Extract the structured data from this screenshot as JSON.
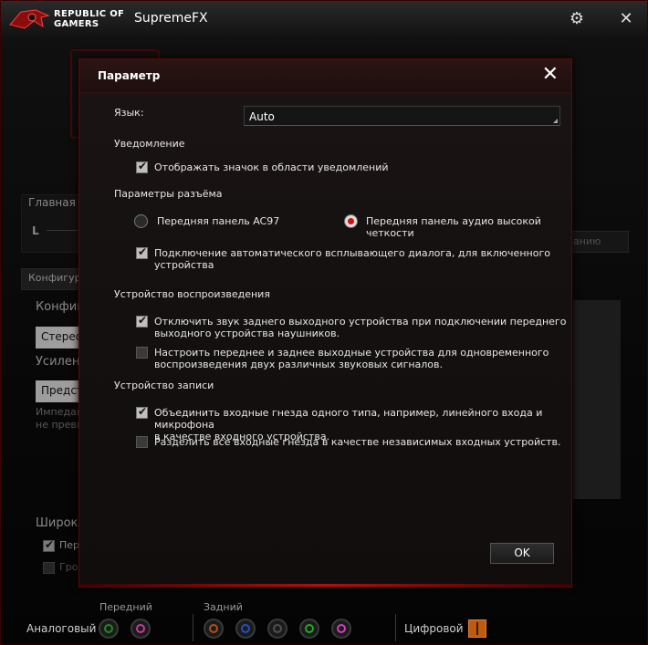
{
  "window": {
    "brand_line1": "REPUBLIC OF",
    "brand_line2": "GAMERS",
    "title": "SupremeFX"
  },
  "background": {
    "main_group_label": "Главная гр",
    "l_label": "L",
    "config_tab": "Конфигур",
    "config_label": "Конфигу",
    "stereo_value": "Стерео",
    "gain_label": "Усилени",
    "preset_value": "Предст",
    "note_line1": "Импеданс",
    "note_line2": "не превы",
    "right_button": "анию",
    "wide_label": "Широко",
    "checkbox1": "Пер",
    "checkbox2": "Гро"
  },
  "bottom": {
    "front_label": "Передний",
    "rear_label": "Задний",
    "analog_label": "Аналоговый",
    "digital_label": "Цифровой",
    "jack_colors": {
      "front": [
        "#1f8a1f",
        "#c03c9a"
      ],
      "rear": [
        "#b0501a",
        "#2050c0",
        "#505050",
        "#22aa22",
        "#d040c0"
      ]
    }
  },
  "dialog": {
    "title": "Параметр",
    "language_label": "Язык:",
    "language_value": "Auto",
    "notification_section": "Уведомление",
    "notification_checkbox": "Отображать значок в области уведомлений",
    "connector_section": "Параметры разъёма",
    "radio_ac97": "Передняя панель AC97",
    "radio_hd_line1": "Передняя панель аудио высокой",
    "radio_hd_line2": "четкости",
    "auto_popup_line1": "Подключение автоматического всплывающего диалога, для включенного",
    "auto_popup_line2": "устройства",
    "playback_section": "Устройство воспроизведения",
    "mute_rear_line1": "Отключить звук заднего выходного устройства при подключении переднего",
    "mute_rear_line2": "выходного устройства наушников.",
    "independent_line1": "Настроить переднее и заднее выходные устройства для одновременного",
    "independent_line2": "воспроизведения двух различных звуковых сигналов.",
    "recording_section": "Устройство записи",
    "combine_line1": "Объединить входные гнезда одного типа, например, линейного входа и микрофона",
    "combine_line2": "в качестве входного устройства.",
    "separate_inputs": "Разделить все входные гнезда в качестве независимых входных устройств.",
    "ok_label": "OK"
  }
}
